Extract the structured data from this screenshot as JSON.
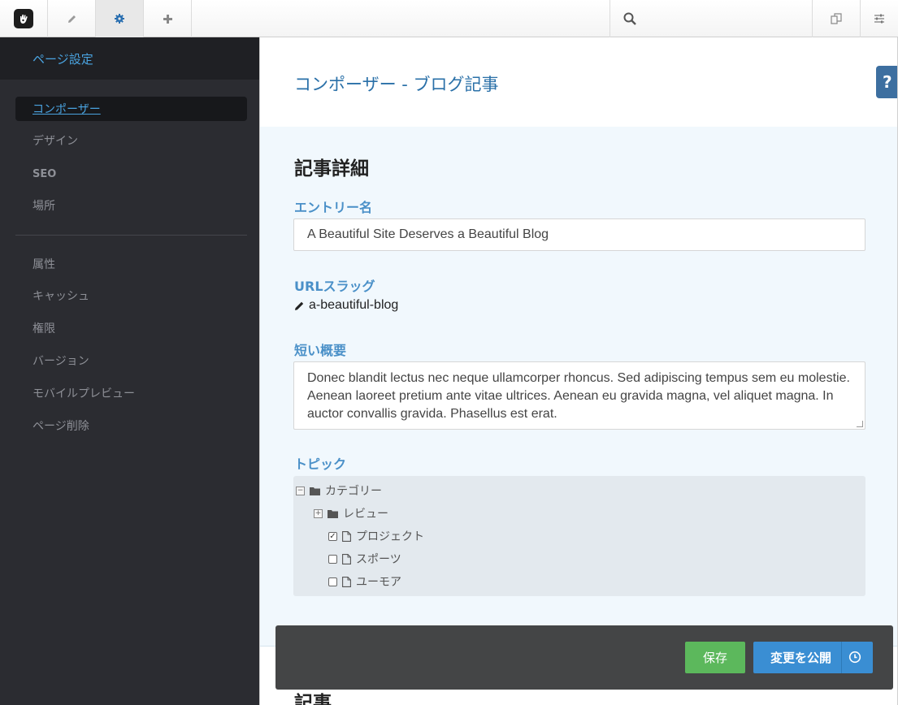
{
  "toolbar": {
    "logo_icon": "concrete5-hand-icon",
    "edit_icon": "pencil-icon",
    "settings_icon": "gear-icon",
    "add_icon": "plus-icon",
    "search_icon": "search-icon",
    "pages_icon": "copy-pages-icon",
    "panel_icon": "sliders-icon",
    "accent": "#2a6fb0"
  },
  "sidebar": {
    "header": "ページ設定",
    "items": [
      {
        "label": "コンポーザー"
      },
      {
        "label": "デザイン"
      },
      {
        "label": "SEO"
      },
      {
        "label": "場所"
      },
      {
        "label": "属性"
      },
      {
        "label": "キャッシュ"
      },
      {
        "label": "権限"
      },
      {
        "label": "バージョン"
      },
      {
        "label": "モバイルプレビュー"
      },
      {
        "label": "ページ削除"
      }
    ]
  },
  "main": {
    "title": "コンポーザー - ブログ記事",
    "help_label": "?",
    "section_title": "記事詳細",
    "entry_name_label": "エントリー名",
    "entry_name_value": "A Beautiful Site Deserves a Beautiful Blog",
    "url_slug_label": "URLスラッグ",
    "url_slug_value": "a-beautiful-blog",
    "summary_label": "短い概要",
    "summary_value": "Donec blandit lectus nec neque ullamcorper rhoncus. Sed adipiscing tempus sem eu molestie. Aenean laoreet pretium ante vitae ultrices. Aenean eu gravida magna, vel aliquet magna. In auctor convallis gravida. Phasellus est erat.",
    "topics_label": "トピック",
    "topics": {
      "root": "カテゴリー",
      "group": "レビュー",
      "items": [
        {
          "label": "プロジェクト",
          "checked": true
        },
        {
          "label": "スポーツ",
          "checked": false
        },
        {
          "label": "ユーモア",
          "checked": false
        }
      ]
    },
    "section2_title": "記事"
  },
  "actions": {
    "save_label": "保存",
    "publish_label": "変更を公開",
    "save_color": "#5cb85c",
    "publish_color": "#3a8ed3"
  }
}
